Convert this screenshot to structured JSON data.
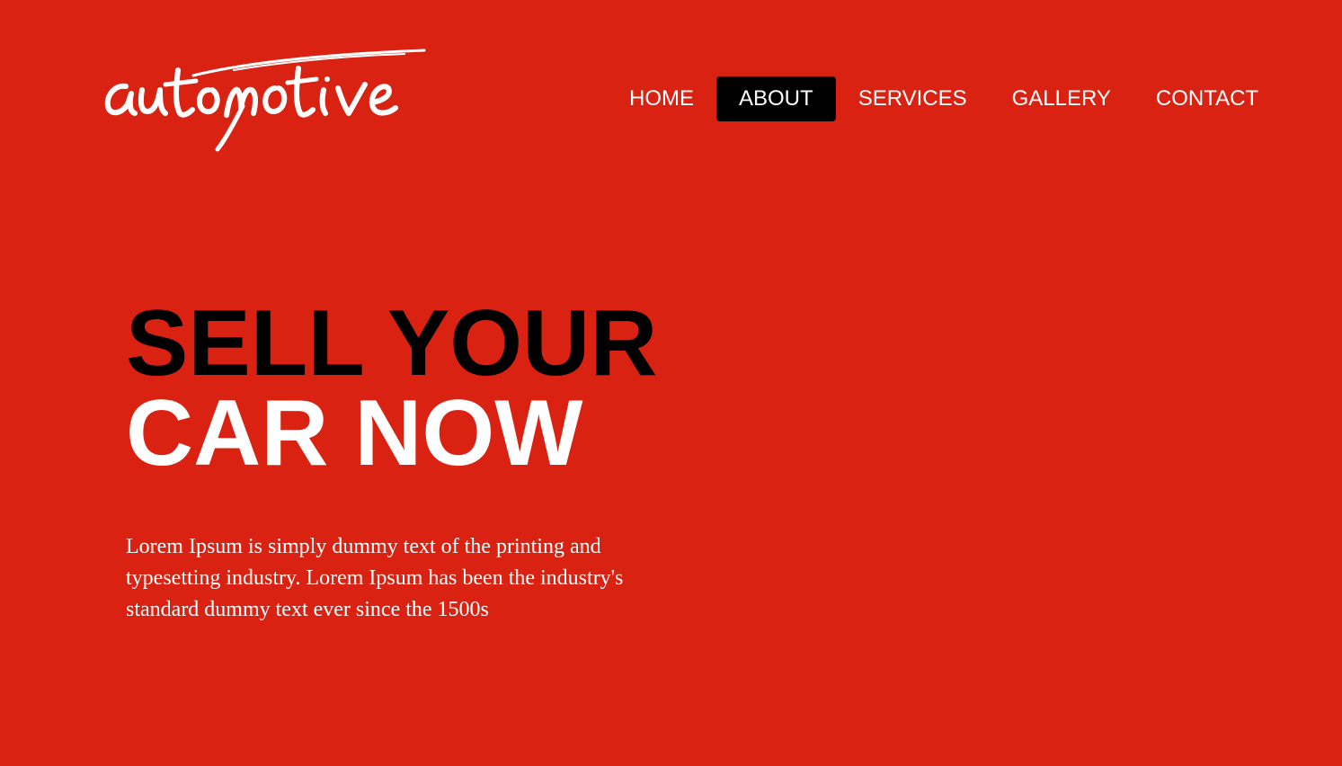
{
  "brand": {
    "logo_text": "automotive"
  },
  "nav": {
    "items": [
      {
        "label": "HOME",
        "active": false
      },
      {
        "label": "ABOUT",
        "active": true
      },
      {
        "label": "SERVICES",
        "active": false
      },
      {
        "label": "GALLERY",
        "active": false
      },
      {
        "label": "CONTACT",
        "active": false
      }
    ]
  },
  "hero": {
    "title_line1": "SELL YOUR",
    "title_line2": "CAR NOW",
    "body": "Lorem Ipsum is simply dummy text of the printing and typesetting industry. Lorem Ipsum has been the industry's standard dummy text ever since the 1500s"
  },
  "colors": {
    "background": "#d92212",
    "active_nav_bg": "#000000",
    "text_light": "#ffffff",
    "text_dark": "#000000"
  }
}
